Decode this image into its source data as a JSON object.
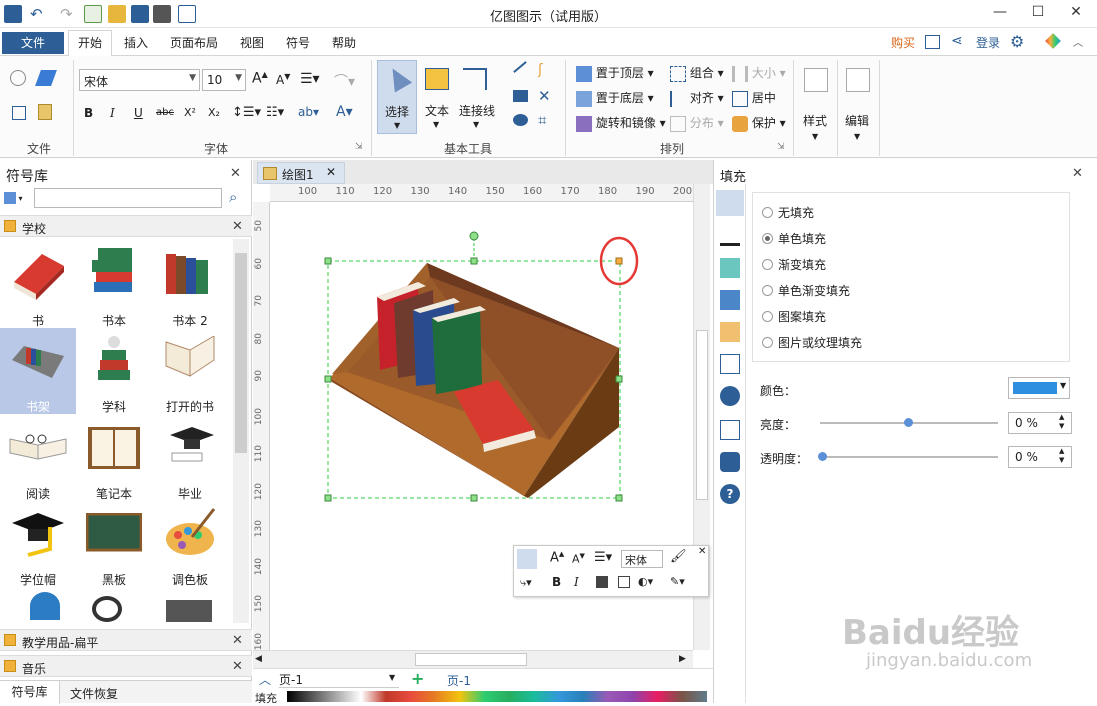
{
  "app": {
    "title": "亿图图示（试用版）"
  },
  "window": {
    "minimize": "—",
    "maximize": "☐",
    "close": "✕"
  },
  "ribbon_tabs": {
    "file": "文件",
    "tabs": [
      "开始",
      "插入",
      "页面布局",
      "视图",
      "符号",
      "帮助"
    ],
    "right": {
      "buy": "购买",
      "login": "登录"
    }
  },
  "ribbon": {
    "groups": {
      "file": "文件",
      "font": "字体",
      "basic_tools": "基本工具",
      "arrange": "排列"
    },
    "font_name": "宋体",
    "font_size": "10",
    "tools": {
      "select": "选择",
      "text": "文本",
      "connector": "连接线"
    },
    "arrange": {
      "bring_front": "置于顶层",
      "send_back": "置于底层",
      "rotate_mirror": "旋转和镜像",
      "group": "组合",
      "align": "对齐",
      "distribute": "分布",
      "size": "大小",
      "center": "居中",
      "protect": "保护"
    },
    "style": "样式",
    "edit": "编辑"
  },
  "symbol_library": {
    "title": "符号库",
    "search_placeholder": "",
    "category": "学校",
    "items": [
      {
        "label": "书"
      },
      {
        "label": "书本"
      },
      {
        "label": "书本 2"
      },
      {
        "label": "书架"
      },
      {
        "label": "学科"
      },
      {
        "label": "打开的书"
      },
      {
        "label": "阅读"
      },
      {
        "label": "笔记本"
      },
      {
        "label": "毕业"
      },
      {
        "label": "学位帽"
      },
      {
        "label": "黑板"
      },
      {
        "label": "调色板"
      }
    ],
    "other_categories": [
      "教学用品-扁平",
      "音乐"
    ],
    "bottom_tabs": [
      "符号库",
      "文件恢复"
    ]
  },
  "document": {
    "tab": "绘图1",
    "ruler_top": [
      "100",
      "110",
      "120",
      "130",
      "140",
      "150",
      "160",
      "170",
      "180",
      "190",
      "200"
    ],
    "ruler_left": [
      "50",
      "60",
      "70",
      "80",
      "90",
      "100",
      "110",
      "120",
      "130",
      "140",
      "150",
      "160"
    ],
    "page_select": "页-1",
    "page_tab": "页-1",
    "fill_label": "填充"
  },
  "mini_toolbar": {
    "font": "宋体"
  },
  "fill_panel": {
    "title": "填充",
    "options": [
      "无填充",
      "单色填充",
      "渐变填充",
      "单色渐变填充",
      "图案填充",
      "图片或纹理填充"
    ],
    "selected": "单色填充",
    "color_label": "颜色：",
    "color_value": "#2e8ee0",
    "brightness_label": "亮度：",
    "brightness_value": "0 %",
    "transparency_label": "透明度：",
    "transparency_value": "0 %"
  },
  "watermark": {
    "brand": "Baidu经验",
    "url": "jingyan.baidu.com"
  }
}
